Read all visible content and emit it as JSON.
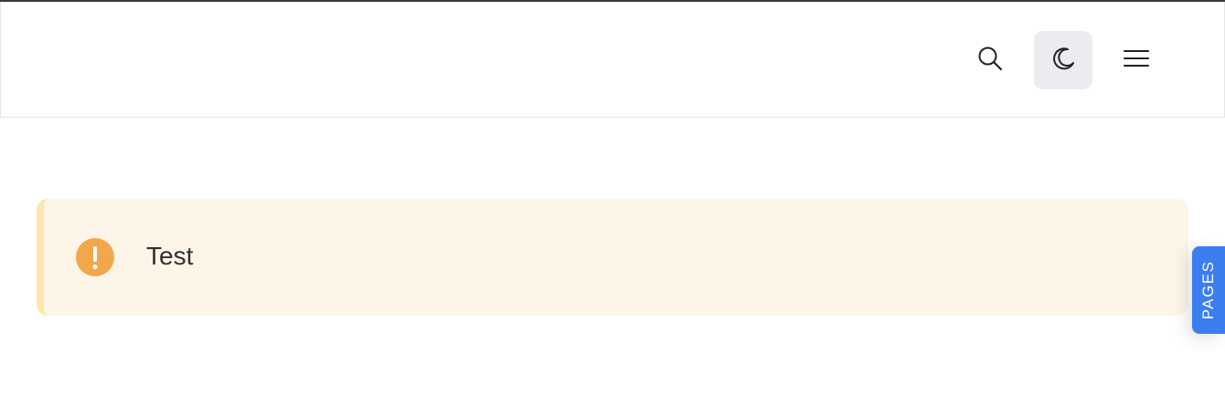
{
  "header": {
    "buttons": [
      {
        "name": "search",
        "icon": "search-icon"
      },
      {
        "name": "theme-toggle",
        "icon": "moon-icon"
      },
      {
        "name": "menu",
        "icon": "hamburger-menu-icon"
      }
    ]
  },
  "callout": {
    "icon": "exclamation-circle-icon",
    "text": "Test",
    "colors": {
      "background": "#fdf6e8",
      "border": "#fde7b0",
      "icon": "#f2a74b"
    }
  },
  "side_tab": {
    "label": "PAGES",
    "color": "#3b7ef2"
  }
}
